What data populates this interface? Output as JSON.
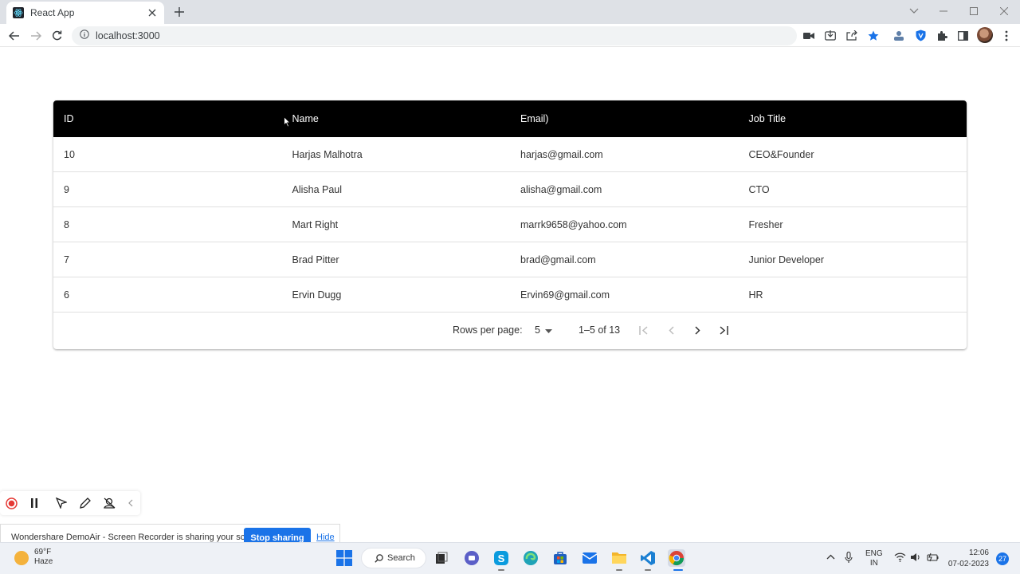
{
  "browser": {
    "tab_title": "React App",
    "url": "localhost:3000"
  },
  "table": {
    "headers": [
      "ID",
      "Name",
      "Email)",
      "Job Title"
    ],
    "rows": [
      {
        "id": "10",
        "name": "Harjas Malhotra",
        "email": "harjas@gmail.com",
        "job": "CEO&Founder"
      },
      {
        "id": "9",
        "name": "Alisha Paul",
        "email": "alisha@gmail.com",
        "job": "CTO"
      },
      {
        "id": "8",
        "name": "Mart Right",
        "email": "marrk9658@yahoo.com",
        "job": "Fresher"
      },
      {
        "id": "7",
        "name": "Brad Pitter",
        "email": "brad@gmail.com",
        "job": "Junior Developer"
      },
      {
        "id": "6",
        "name": "Ervin Dugg",
        "email": "Ervin69@gmail.com",
        "job": "HR"
      }
    ],
    "header_bg": "#000000"
  },
  "pagination": {
    "rows_per_page_label": "Rows per page:",
    "rows_per_page_value": "5",
    "range_text": "1–5 of 13"
  },
  "recorder": {
    "share_message": "Wondershare DemoAir - Screen Recorder is sharing your screen.",
    "stop_label": "Stop sharing",
    "hide_label": "Hide"
  },
  "taskbar": {
    "weather_temp": "69°F",
    "weather_desc": "Haze",
    "search_label": "Search",
    "lang_line1": "ENG",
    "lang_line2": "IN",
    "time": "12:06",
    "date": "07-02-2023",
    "notification_count": "27"
  },
  "colors": {
    "accent_blue": "#1a73e8",
    "record_red": "#e53935"
  }
}
